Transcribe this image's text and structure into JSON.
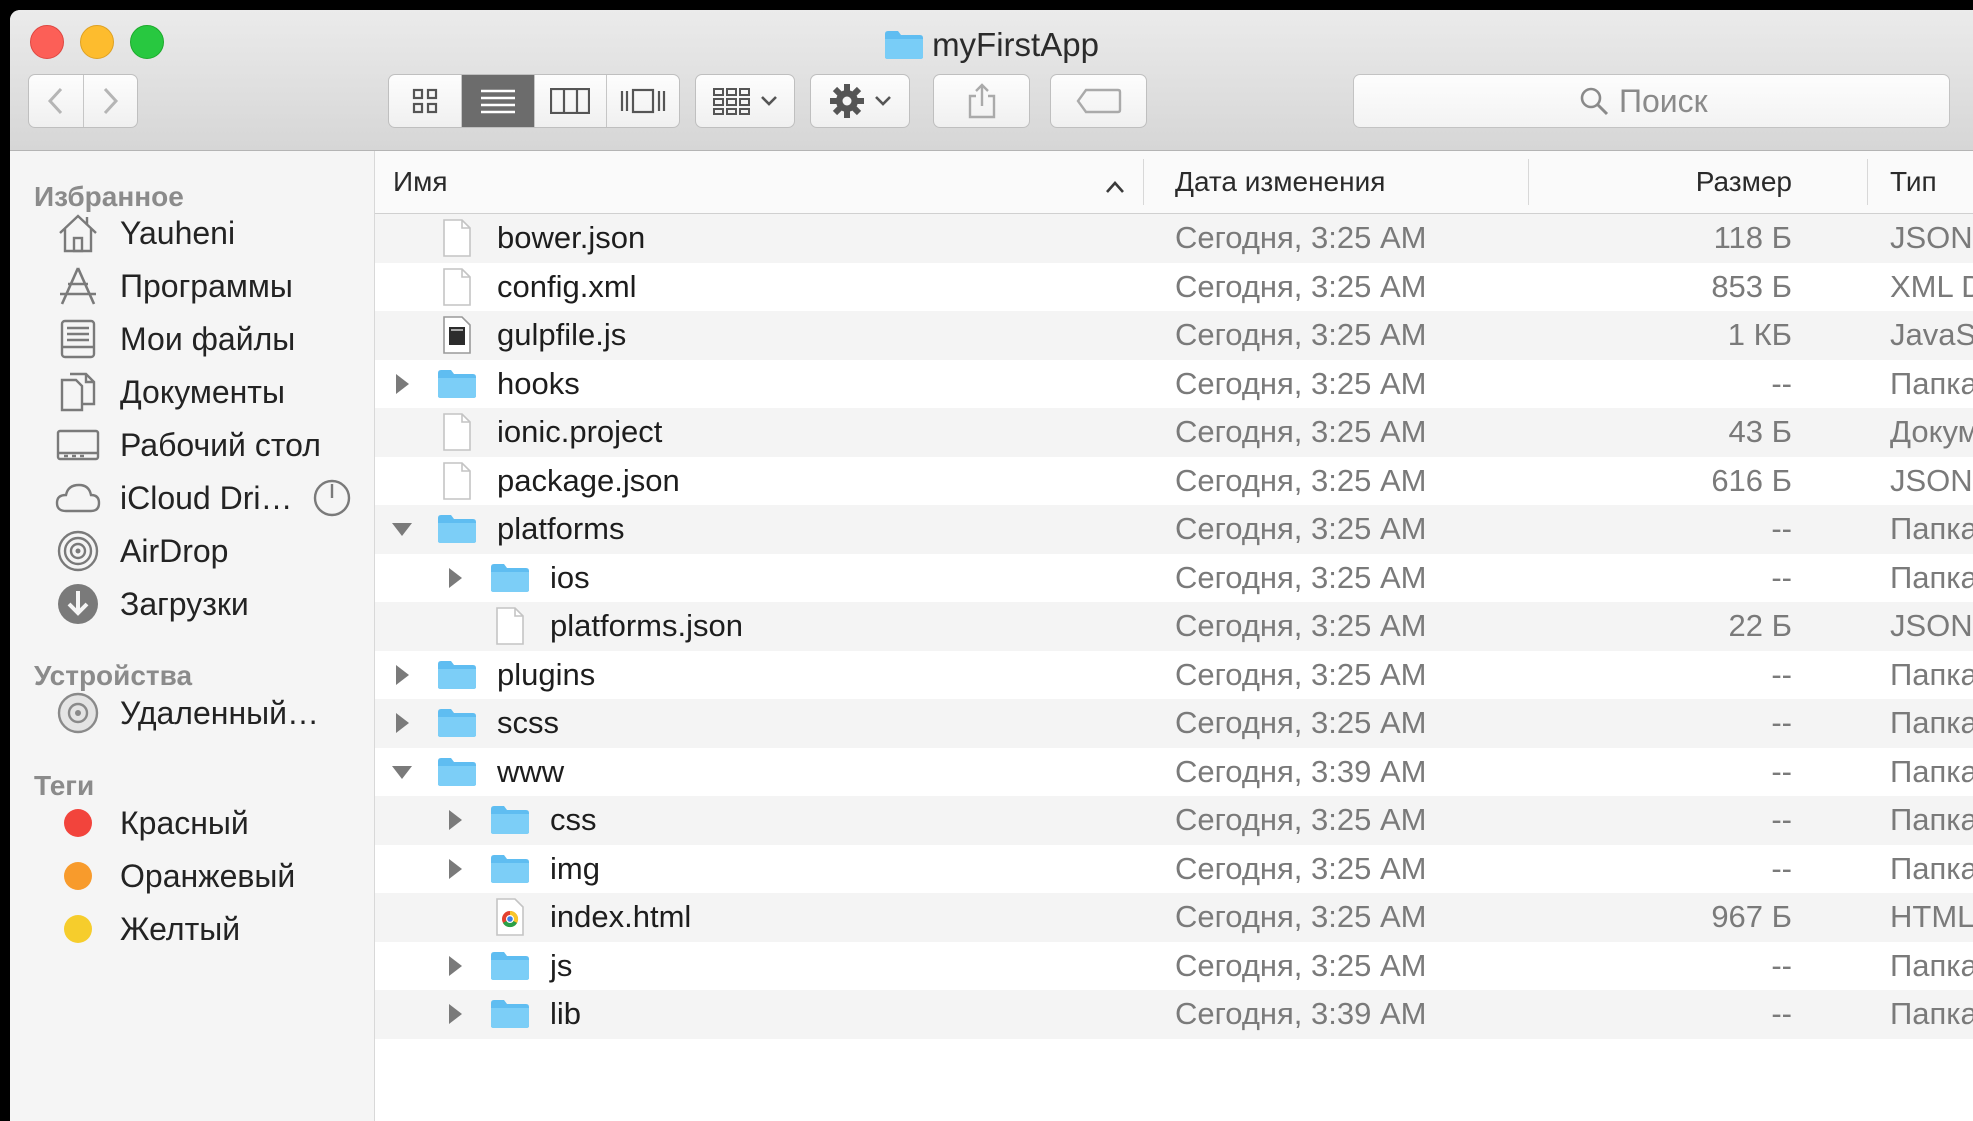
{
  "window": {
    "title": "myFirstApp"
  },
  "toolbar": {
    "search_placeholder": "Поиск",
    "search_value": ""
  },
  "sidebar": {
    "favorites_title": "Избранное",
    "favorites": [
      {
        "label": "Yauheni",
        "icon": "home-icon"
      },
      {
        "label": "Программы",
        "icon": "applications-icon"
      },
      {
        "label": "Мои файлы",
        "icon": "all-my-files-icon"
      },
      {
        "label": "Документы",
        "icon": "documents-icon"
      },
      {
        "label": "Рабочий стол",
        "icon": "desktop-icon"
      },
      {
        "label": "iCloud Dri…",
        "icon": "icloud-icon"
      },
      {
        "label": "AirDrop",
        "icon": "airdrop-icon"
      },
      {
        "label": "Загрузки",
        "icon": "downloads-icon"
      }
    ],
    "devices_title": "Устройства",
    "devices": [
      {
        "label": "Удаленный…",
        "icon": "remote-disc-icon"
      }
    ],
    "tags_title": "Теги",
    "tags": [
      {
        "label": "Красный",
        "color": "#f2443c"
      },
      {
        "label": "Оранжевый",
        "color": "#f89b2c"
      },
      {
        "label": "Желтый",
        "color": "#f6cd2c"
      }
    ]
  },
  "columns": {
    "name": "Имя",
    "date": "Дата изменения",
    "size": "Размер",
    "type": "Тип"
  },
  "files": [
    {
      "name": "bower.json",
      "date": "Сегодня, 3:25 AM",
      "size": "118 Б",
      "type": "JSON",
      "kind": "file",
      "depth": 0,
      "disclosure": "none"
    },
    {
      "name": "config.xml",
      "date": "Сегодня, 3:25 AM",
      "size": "853 Б",
      "type": "XML D",
      "kind": "file",
      "depth": 0,
      "disclosure": "none"
    },
    {
      "name": "gulpfile.js",
      "date": "Сегодня, 3:25 AM",
      "size": "1 КБ",
      "type": "JavaSc",
      "kind": "exec",
      "depth": 0,
      "disclosure": "none"
    },
    {
      "name": "hooks",
      "date": "Сегодня, 3:25 AM",
      "size": "--",
      "type": "Папка",
      "kind": "folder",
      "depth": 0,
      "disclosure": "collapsed"
    },
    {
      "name": "ionic.project",
      "date": "Сегодня, 3:25 AM",
      "size": "43 Б",
      "type": "Докум",
      "kind": "file",
      "depth": 0,
      "disclosure": "none"
    },
    {
      "name": "package.json",
      "date": "Сегодня, 3:25 AM",
      "size": "616 Б",
      "type": "JSON",
      "kind": "file",
      "depth": 0,
      "disclosure": "none"
    },
    {
      "name": "platforms",
      "date": "Сегодня, 3:25 AM",
      "size": "--",
      "type": "Папка",
      "kind": "folder",
      "depth": 0,
      "disclosure": "expanded"
    },
    {
      "name": "ios",
      "date": "Сегодня, 3:25 AM",
      "size": "--",
      "type": "Папка",
      "kind": "folder",
      "depth": 1,
      "disclosure": "collapsed"
    },
    {
      "name": "platforms.json",
      "date": "Сегодня, 3:25 AM",
      "size": "22 Б",
      "type": "JSON",
      "kind": "file",
      "depth": 1,
      "disclosure": "none"
    },
    {
      "name": "plugins",
      "date": "Сегодня, 3:25 AM",
      "size": "--",
      "type": "Папка",
      "kind": "folder",
      "depth": 0,
      "disclosure": "collapsed"
    },
    {
      "name": "scss",
      "date": "Сегодня, 3:25 AM",
      "size": "--",
      "type": "Папка",
      "kind": "folder",
      "depth": 0,
      "disclosure": "collapsed"
    },
    {
      "name": "www",
      "date": "Сегодня, 3:39 AM",
      "size": "--",
      "type": "Папка",
      "kind": "folder",
      "depth": 0,
      "disclosure": "expanded"
    },
    {
      "name": "css",
      "date": "Сегодня, 3:25 AM",
      "size": "--",
      "type": "Папка",
      "kind": "folder",
      "depth": 1,
      "disclosure": "collapsed"
    },
    {
      "name": "img",
      "date": "Сегодня, 3:25 AM",
      "size": "--",
      "type": "Папка",
      "kind": "folder",
      "depth": 1,
      "disclosure": "collapsed"
    },
    {
      "name": "index.html",
      "date": "Сегодня, 3:25 AM",
      "size": "967 Б",
      "type": "HTML.",
      "kind": "html",
      "depth": 1,
      "disclosure": "none"
    },
    {
      "name": "js",
      "date": "Сегодня, 3:25 AM",
      "size": "--",
      "type": "Папка",
      "kind": "folder",
      "depth": 1,
      "disclosure": "collapsed"
    },
    {
      "name": "lib",
      "date": "Сегодня, 3:39 AM",
      "size": "--",
      "type": "Папка",
      "kind": "folder",
      "depth": 1,
      "disclosure": "collapsed"
    }
  ]
}
